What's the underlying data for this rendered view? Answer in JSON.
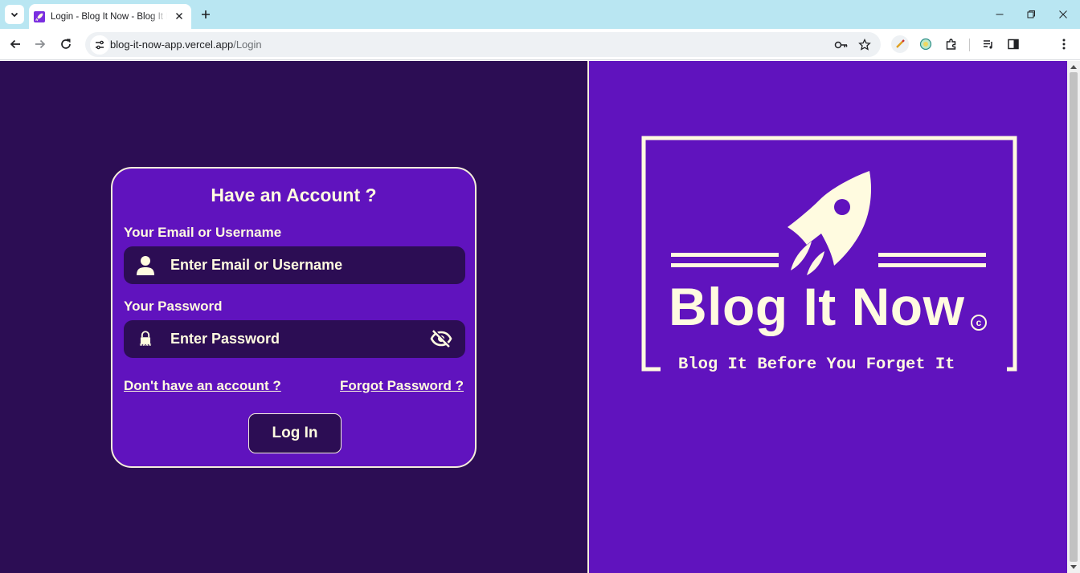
{
  "browser": {
    "tab_title": "Login - Blog It Now - Blog It Before You Forget It",
    "url_host": "blog-it-now-app.vercel.app",
    "url_path": "/Login"
  },
  "login_form": {
    "heading": "Have an Account ?",
    "email_label": "Your Email or Username",
    "email_placeholder": "Enter Email or Username",
    "email_value": "",
    "password_label": "Your Password",
    "password_placeholder": "Enter Password",
    "password_value": "",
    "signup_link": "Don't have an account ?",
    "forgot_link": "Forgot Password ?",
    "login_button": "Log In"
  },
  "brand": {
    "name": "Blog It Now",
    "tagline": "Blog It Before You Forget It",
    "copyright_symbol": "c"
  },
  "colors": {
    "dark_purple": "#2c0d54",
    "purple": "#6013be",
    "cream": "#fffbe0",
    "tab_bar": "#b9e6f2"
  },
  "icons": [
    "chevron-down-icon",
    "rocket-favicon",
    "close-icon",
    "plus-icon",
    "minimize-icon",
    "restore-icon",
    "back-arrow-icon",
    "forward-arrow-icon",
    "reload-icon",
    "site-settings-icon",
    "key-icon",
    "star-icon",
    "extension-icon",
    "puzzle-icon",
    "media-icon",
    "sidepanel-icon",
    "kebab-menu-icon",
    "user-icon",
    "lock-icon",
    "eye-slash-icon",
    "rocket-logo"
  ]
}
